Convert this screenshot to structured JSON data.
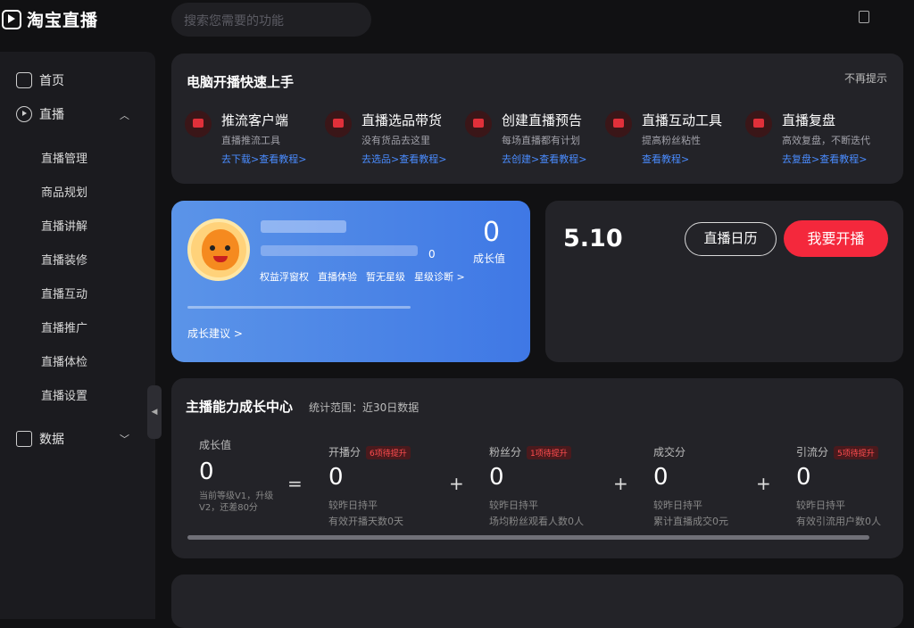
{
  "app": {
    "logo": "淘宝直播"
  },
  "search": {
    "placeholder": "搜索您需要的功能"
  },
  "nav": [
    {
      "label": "首页",
      "icon": "home-icon"
    },
    {
      "label": "直播",
      "icon": "play-icon",
      "expanded": true,
      "children": [
        "直播管理",
        "商品规划",
        "直播讲解",
        "直播装修",
        "直播互动",
        "直播推广",
        "直播体检",
        "直播设置"
      ]
    },
    {
      "label": "数据",
      "icon": "data-icon",
      "expanded": false
    }
  ],
  "quick": {
    "title": "电脑开播快速上手",
    "dismiss": "不再提示",
    "items": [
      {
        "name": "推流客户端",
        "desc": "直播推流工具",
        "links": "去下载>查看教程>"
      },
      {
        "name": "直播选品带货",
        "desc": "没有货品去这里",
        "links": "去选品>查看教程>"
      },
      {
        "name": "创建直播预告",
        "desc": "每场直播都有计划",
        "links": "去创建>查看教程>"
      },
      {
        "name": "直播互动工具",
        "desc": "提高粉丝粘性",
        "links": "查看教程>"
      },
      {
        "name": "直播复盘",
        "desc": "高效复盘，不断迭代",
        "links": "去复盘>查看教程>"
      }
    ]
  },
  "growth": {
    "value": "0",
    "label": "成长值",
    "zero": "0",
    "tags": [
      "权益浮窗权",
      "直播体验",
      "暂无星级",
      "星级诊断 >"
    ],
    "advice": "成长建议 >"
  },
  "live": {
    "date": "5.10",
    "calendar": "直播日历",
    "start": "我要开播"
  },
  "stats": {
    "title": "主播能力成长中心",
    "range": "统计范围：近30日数据",
    "growth_label": "成长值",
    "growth_value": "0",
    "growth_note": "当前等级V1，升级V2，还差80分",
    "metrics": [
      {
        "name": "开播分",
        "tag": "6项待提升",
        "value": "0",
        "cmp": "较昨日持平",
        "desc": "有效开播天数0天"
      },
      {
        "name": "粉丝分",
        "tag": "1项待提升",
        "value": "0",
        "cmp": "较昨日持平",
        "desc": "场均粉丝观看人数0人"
      },
      {
        "name": "成交分",
        "tag": "",
        "value": "0",
        "cmp": "较昨日持平",
        "desc": "累计直播成交0元"
      },
      {
        "name": "引流分",
        "tag": "5项待提升",
        "value": "0",
        "cmp": "较昨日持平",
        "desc": "有效引流用户数0人"
      }
    ]
  },
  "colors": {
    "bg": "#111113",
    "card": "#232328",
    "accent": "#f4283c",
    "link": "#4a8cff",
    "blue": "#4a86e8"
  }
}
